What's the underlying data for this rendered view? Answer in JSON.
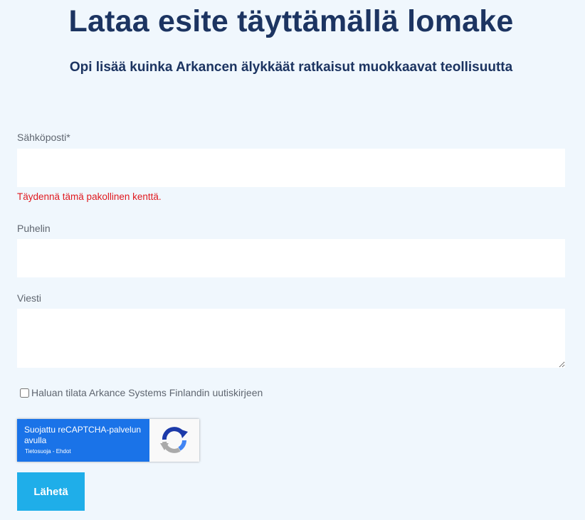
{
  "header": {
    "title": "Lataa esite täyttämällä lomake",
    "subtitle": "Opi lisää kuinka Arkancen älykkäät ratkaisut muokkaavat teollisuutta"
  },
  "form": {
    "email": {
      "label": "Sähköposti*",
      "value": "",
      "error": "Täydennä tämä pakollinen kenttä."
    },
    "phone": {
      "label": "Puhelin",
      "value": ""
    },
    "message": {
      "label": "Viesti",
      "value": ""
    },
    "newsletter": {
      "label": "Haluan tilata Arkance Systems Finlandin uutiskirjeen",
      "checked": false
    },
    "recaptcha": {
      "text": "Suojattu reCAPTCHA-palvelun avulla",
      "links": "Tietosuoja - Ehdot",
      "icon": "recaptcha-logo-icon"
    },
    "submit_label": "Lähetä"
  },
  "colors": {
    "background": "#f0f7fd",
    "title": "#1c3461",
    "error": "#e0191f",
    "button": "#1faee9",
    "recaptcha_blue": "#1a73e8"
  }
}
